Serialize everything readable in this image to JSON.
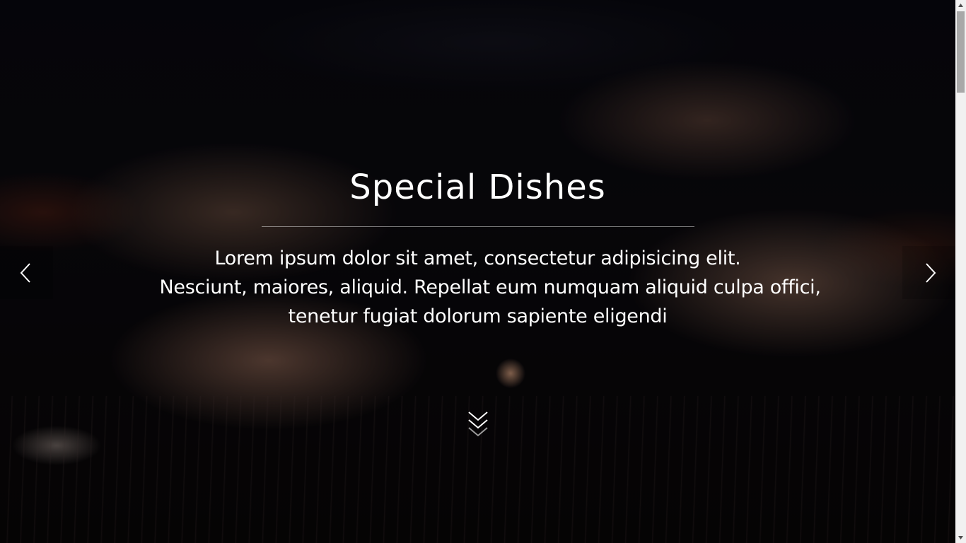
{
  "hero": {
    "title": "Special Dishes",
    "text_lines": [
      "Lorem ipsum dolor sit amet, consectetur adipisicing elit.",
      "Nesciunt, maiores, aliquid. Repellat eum numquam aliquid culpa offici,",
      "tenetur fugiat dolorum sapiente eligendi"
    ],
    "background_image": "grilled-chicken-photo"
  },
  "controls": {
    "prev_icon": "chevron-left-icon",
    "next_icon": "chevron-right-icon",
    "scroll_icon": "double-chevron-down-icon"
  },
  "scrollbar": {
    "position_fraction": 0.0
  },
  "colors": {
    "text": "#ffffff",
    "overlay": "#000000",
    "scrollbar_track": "#f1f1f1",
    "scrollbar_thumb": "#a8a8a8"
  }
}
